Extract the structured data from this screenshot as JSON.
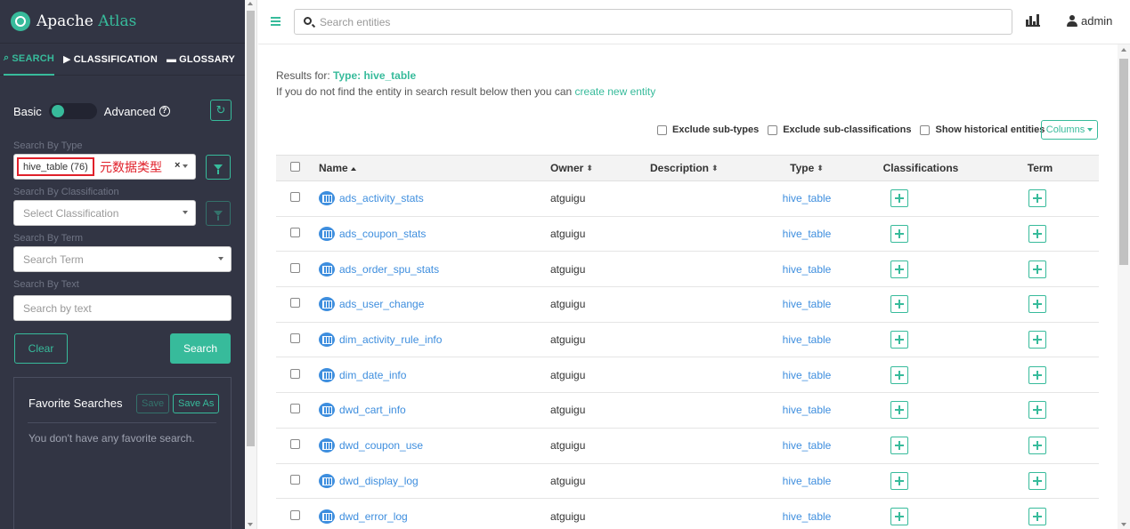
{
  "brand": {
    "name_part1": "Apache ",
    "name_part2": "Atlas"
  },
  "nav_tabs": [
    {
      "label": "SEARCH",
      "icon": "search-icon"
    },
    {
      "label": "CLASSIFICATION",
      "icon": "tag-icon"
    },
    {
      "label": "GLOSSARY",
      "icon": "folder-open-icon"
    }
  ],
  "search_mode": {
    "basic_label": "Basic",
    "advanced_label": "Advanced"
  },
  "search_by_type": {
    "label": "Search By Type",
    "value": "hive_table (76)",
    "annotation": "元数据类型"
  },
  "search_by_classification": {
    "label": "Search By Classification",
    "placeholder": "Select Classification"
  },
  "search_by_term": {
    "label": "Search By Term",
    "placeholder": "Search Term"
  },
  "search_by_text": {
    "label": "Search By Text",
    "placeholder": "Search by text"
  },
  "buttons": {
    "clear": "Clear",
    "search": "Search"
  },
  "favorites": {
    "title": "Favorite Searches",
    "save": "Save",
    "save_as": "Save As",
    "empty": "You don't have any favorite search."
  },
  "header": {
    "search_placeholder": "Search entities",
    "user": "admin"
  },
  "results": {
    "prefix": "Results for: ",
    "type_text": "Type: hive_table",
    "hint": "If you do not find the entity in search result below then you can ",
    "create_link": "create new entity"
  },
  "filters": {
    "exclude_subtypes": "Exclude sub-types",
    "exclude_subclassifications": "Exclude sub-classifications",
    "show_historical": "Show historical entities",
    "columns": "Columns"
  },
  "table": {
    "headers": {
      "name": "Name",
      "owner": "Owner",
      "description": "Description",
      "type": "Type",
      "classifications": "Classifications",
      "term": "Term"
    },
    "rows": [
      {
        "name": "ads_activity_stats",
        "owner": "atguigu",
        "description": "",
        "type": "hive_table"
      },
      {
        "name": "ads_coupon_stats",
        "owner": "atguigu",
        "description": "",
        "type": "hive_table"
      },
      {
        "name": "ads_order_spu_stats",
        "owner": "atguigu",
        "description": "",
        "type": "hive_table"
      },
      {
        "name": "ads_user_change",
        "owner": "atguigu",
        "description": "",
        "type": "hive_table"
      },
      {
        "name": "dim_activity_rule_info",
        "owner": "atguigu",
        "description": "",
        "type": "hive_table"
      },
      {
        "name": "dim_date_info",
        "owner": "atguigu",
        "description": "",
        "type": "hive_table"
      },
      {
        "name": "dwd_cart_info",
        "owner": "atguigu",
        "description": "",
        "type": "hive_table"
      },
      {
        "name": "dwd_coupon_use",
        "owner": "atguigu",
        "description": "",
        "type": "hive_table"
      },
      {
        "name": "dwd_display_log",
        "owner": "atguigu",
        "description": "",
        "type": "hive_table"
      },
      {
        "name": "dwd_error_log",
        "owner": "atguigu",
        "description": "",
        "type": "hive_table"
      }
    ]
  },
  "colors": {
    "accent": "#37bb9b",
    "sidebar": "#323544",
    "link": "#3e8ede",
    "annotation": "#e0202a"
  }
}
